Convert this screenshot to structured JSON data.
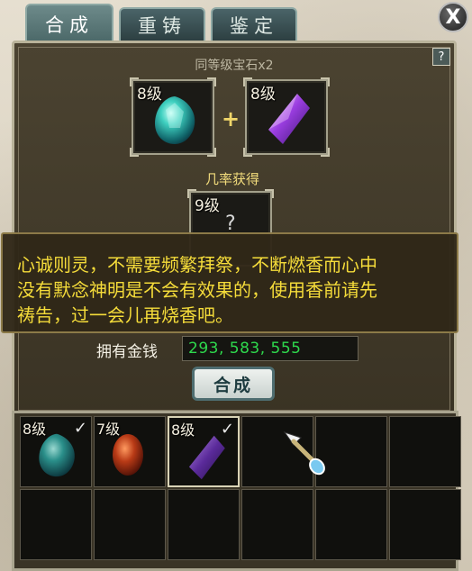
{
  "tabs": [
    {
      "label": "合成",
      "active": true
    },
    {
      "label": "重铸",
      "active": false
    },
    {
      "label": "鉴定",
      "active": false
    }
  ],
  "close_label": "X",
  "help_label": "?",
  "synthesis": {
    "subtitle": "同等级宝石x2",
    "plus": "+",
    "input_slots": [
      {
        "level": "8级",
        "gem": "teal-gem-icon"
      },
      {
        "level": "8级",
        "gem": "purple-crystal-icon"
      }
    ],
    "result_label": "几率获得",
    "result_slot": {
      "level": "9级",
      "gem": "unknown-gem-icon",
      "mark": "?"
    }
  },
  "tooltip": {
    "lines": [
      "心诚则灵，不需要频繁拜祭，不断燃香而心中",
      "没有默念神明是不会有效果的，使用香前请先",
      "祷告，过一会儿再烧香吧。"
    ]
  },
  "money": {
    "label": "拥有金钱",
    "value": "293, 583, 555"
  },
  "synth_button": "合成",
  "inventory": {
    "cells": [
      {
        "level": "8级",
        "gem": "teal-gem-icon",
        "checked": true,
        "selected": false
      },
      {
        "level": "7级",
        "gem": "red-gem-icon",
        "checked": false,
        "selected": false
      },
      {
        "level": "8级",
        "gem": "purple-crystal-icon",
        "checked": true,
        "selected": true
      },
      {
        "level": "",
        "gem": "",
        "checked": false,
        "selected": false
      },
      {
        "level": "",
        "gem": "",
        "checked": false,
        "selected": false
      },
      {
        "level": "",
        "gem": "",
        "checked": false,
        "selected": false
      },
      {
        "level": "",
        "gem": "",
        "checked": false,
        "selected": false
      },
      {
        "level": "",
        "gem": "",
        "checked": false,
        "selected": false
      },
      {
        "level": "",
        "gem": "",
        "checked": false,
        "selected": false
      },
      {
        "level": "",
        "gem": "",
        "checked": false,
        "selected": false
      },
      {
        "level": "",
        "gem": "",
        "checked": false,
        "selected": false
      },
      {
        "level": "",
        "gem": "",
        "checked": false,
        "selected": false
      }
    ],
    "check_mark": "✓"
  },
  "colors": {
    "tooltip_text": "#f5dc3a",
    "money_text": "#2ed94d",
    "result_label": "#f2dc7c"
  }
}
